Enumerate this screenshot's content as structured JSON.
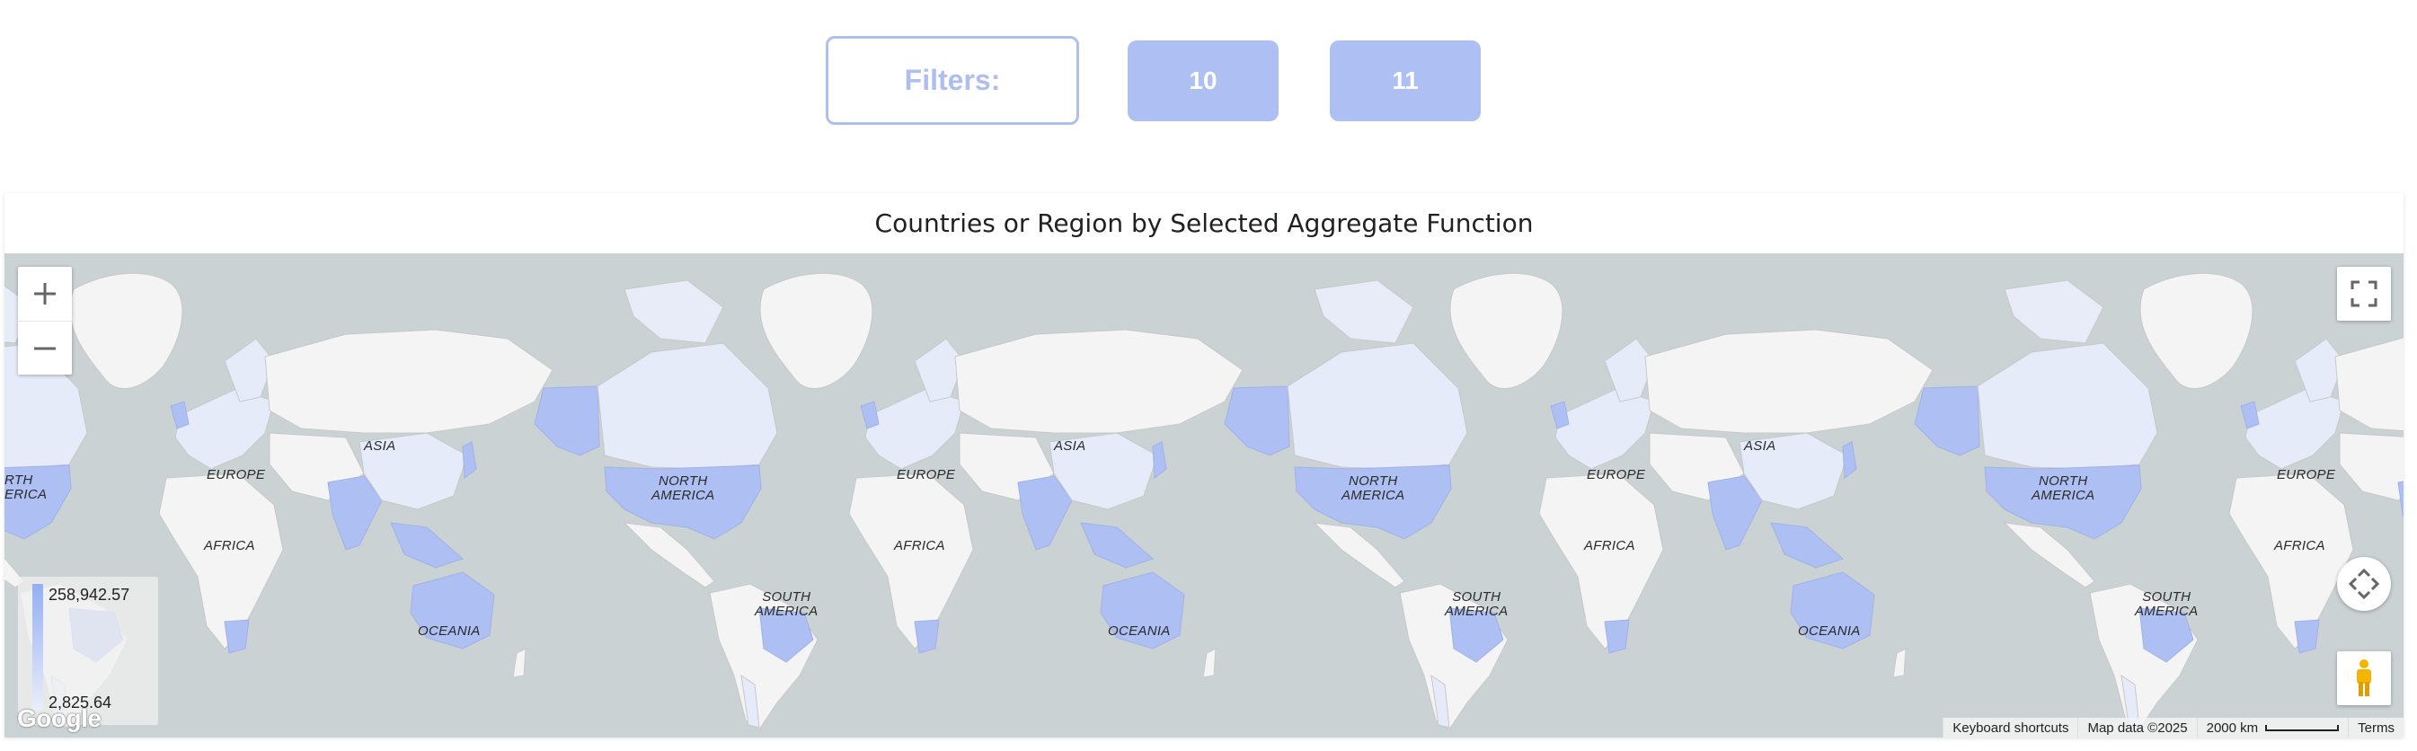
{
  "filters": {
    "label": "Filters:",
    "buttons": [
      "10",
      "11"
    ]
  },
  "map": {
    "title": "Countries or Region by Selected Aggregate Function",
    "continent_labels": {
      "asia": "ASIA",
      "europe": "EUROPE",
      "africa": "AFRICA",
      "north_america": "NORTH\nAMERICA",
      "north_america_clipped": "RTH\nERICA",
      "south_america": "SOUTH\nAMERICA",
      "oceania": "OCEANIA"
    },
    "legend": {
      "max": "258,942.57",
      "min": "2,825.64",
      "color_high": "#93aef2",
      "color_low": "#e9eefb"
    },
    "controls": {
      "zoom_in_icon": "plus-icon",
      "zoom_out_icon": "minus-icon",
      "fullscreen_icon": "fullscreen-icon",
      "pan_icon": "camera-pan-icon",
      "street_view_icon": "pegman-icon"
    },
    "logo_text": "Google",
    "attribution": {
      "shortcuts": "Keyboard shortcuts",
      "map_data": "Map data ©2025",
      "scale": "2000 km",
      "terms": "Terms"
    },
    "colors": {
      "water": "#cbd2d3",
      "land": "#f4f4f4",
      "highlight_strong": "#aec0f3",
      "highlight_light": "#e6ebfa"
    }
  }
}
